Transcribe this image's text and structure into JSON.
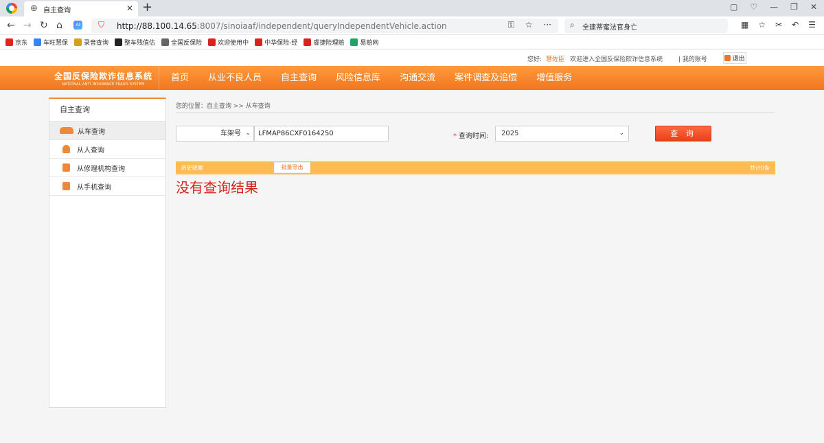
{
  "browser": {
    "tab_title": "自主查询",
    "url_host": "http://88.100.14.65",
    "url_path": ":8007/sinoiaaf/independent/queryIndependentVehicle.action",
    "search_text": "全建蒂蜜法官身亡",
    "bookmarks": [
      {
        "label": "京东",
        "color": "#e1251b"
      },
      {
        "label": "车旺慧保",
        "color": "#3b82f6"
      },
      {
        "label": "录音查询",
        "color": "#d4a017"
      },
      {
        "label": "整车残值估",
        "color": "#222222"
      },
      {
        "label": "全国反保险",
        "color": "#666666"
      },
      {
        "label": "欢迎使用中",
        "color": "#d9231d"
      },
      {
        "label": "中华保险-经",
        "color": "#d9231d"
      },
      {
        "label": "睿捷险理赔",
        "color": "#d9231d"
      },
      {
        "label": "易赔网",
        "color": "#21a366"
      }
    ]
  },
  "header": {
    "greeting": "您好:",
    "username": "慧佐臣",
    "welcome": "欢迎进入全国反保险欺诈信息系统",
    "account": "| 我的账号",
    "logout": "退出"
  },
  "brand": {
    "cn": "全国反保险欺诈信息系统",
    "en": "NATIONAL ANTI INSURANCE FRAUD SYSTEM"
  },
  "nav": {
    "items": [
      "首页",
      "从业不良人员",
      "自主查询",
      "风险信息库",
      "沟通交流",
      "案件调查及追偿",
      "增值服务"
    ]
  },
  "sidebar": {
    "title": "自主查询",
    "items": [
      {
        "label": "从车查询",
        "icon": "car-icon"
      },
      {
        "label": "从人查询",
        "icon": "person-icon"
      },
      {
        "label": "从修理机构查询",
        "icon": "repair-shop-icon"
      },
      {
        "label": "从手机查询",
        "icon": "phone-icon"
      }
    ]
  },
  "main": {
    "breadcrumb": "您的位置：自主查询 >> 从车查询",
    "query_type": "车架号",
    "vin_value": "LFMAP86CXF0164250",
    "time_label": "查询时间:",
    "time_required": "*",
    "year": "2025",
    "query_button": "查 询",
    "history_label": "历史赔案",
    "export_button": "批量导出",
    "count": "共计0条",
    "no_result": "没有查询结果"
  }
}
